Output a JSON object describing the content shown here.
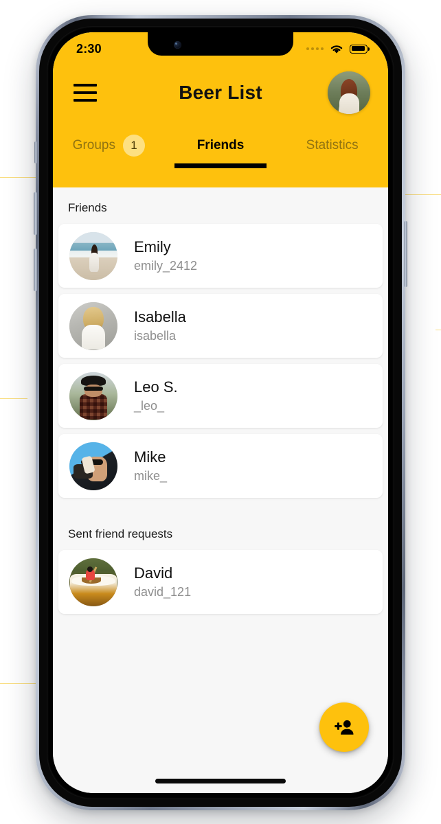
{
  "status_bar": {
    "time": "2:30",
    "signal_icon": "cellular-dots-icon",
    "wifi_icon": "wifi-icon",
    "battery_icon": "battery-full-icon"
  },
  "header": {
    "menu_icon": "hamburger-menu-icon",
    "title": "Beer List",
    "avatar_icon": "user-avatar"
  },
  "tabs": [
    {
      "label": "Groups",
      "badge": "1",
      "active": false
    },
    {
      "label": "Friends",
      "badge": null,
      "active": true
    },
    {
      "label": "Statistics",
      "badge": null,
      "active": false
    }
  ],
  "sections": [
    {
      "title": "Friends",
      "rows": [
        {
          "name": "Emily",
          "handle": "emily_2412",
          "avatar": "emily-avatar"
        },
        {
          "name": "Isabella",
          "handle": "isabella",
          "avatar": "isabella-avatar"
        },
        {
          "name": "Leo S.",
          "handle": "_leo_",
          "avatar": "leo-avatar"
        },
        {
          "name": "Mike",
          "handle": "mike_",
          "avatar": "mike-avatar"
        }
      ]
    },
    {
      "title": "Sent friend requests",
      "rows": [
        {
          "name": "David",
          "handle": "david_121",
          "avatar": "david-avatar"
        }
      ]
    }
  ],
  "fab": {
    "icon": "person-add-icon",
    "label": "Add friend"
  },
  "colors": {
    "brand_yellow": "#fec10d",
    "badge_yellow": "#fde89b",
    "content_bg": "#f7f7f7",
    "card_bg": "#ffffff",
    "primary_text": "#111111",
    "secondary_text": "#8e8e8e",
    "accent_black": "#000000"
  }
}
